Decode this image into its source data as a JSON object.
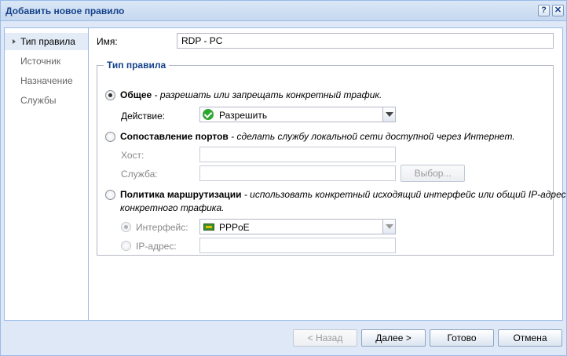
{
  "window": {
    "title": "Добавить новое правило",
    "help_label": "?",
    "close_label": "✕"
  },
  "sidebar": {
    "items": [
      {
        "label": "Тип правила",
        "active": true
      },
      {
        "label": "Источник",
        "active": false
      },
      {
        "label": "Назначение",
        "active": false
      },
      {
        "label": "Службы",
        "active": false
      }
    ]
  },
  "form": {
    "name_label": "Имя:",
    "name_value": "RDP - PC",
    "rule_type_legend": "Тип правила",
    "general": {
      "title": "Общее",
      "description": " - разрешать или запрещать конкретный трафик.",
      "action_label": "Действие:",
      "action_value": "Разрешить",
      "selected": true
    },
    "port_mapping": {
      "title": "Сопоставление портов",
      "description": " - сделать службу локальной сети доступной через Интернет.",
      "host_label": "Хост:",
      "host_value": "",
      "service_label": "Служба:",
      "service_value": "",
      "browse_label": "Выбор...",
      "selected": false
    },
    "routing": {
      "title": "Политика маршрутизации",
      "description_line1": " - использовать конкретный исходящий интерфейс или общий IP-адрес для",
      "description_line2": "конкретного трафика.",
      "interface_label": "Интерфейс:",
      "interface_value": "PPPoE",
      "ip_label": "IP-адрес:",
      "ip_value": "",
      "selected": false,
      "interface_selected": true
    }
  },
  "footer": {
    "back_label": "< Назад",
    "next_label": "Далее >",
    "done_label": "Готово",
    "cancel_label": "Отмена"
  },
  "colors": {
    "title_text": "#15428b",
    "border": "#99bbe8",
    "background": "#dfe8f6",
    "allow_icon": "#2fa532"
  },
  "icons": {
    "action": "check-circle-icon",
    "interface": "network-card-icon"
  }
}
